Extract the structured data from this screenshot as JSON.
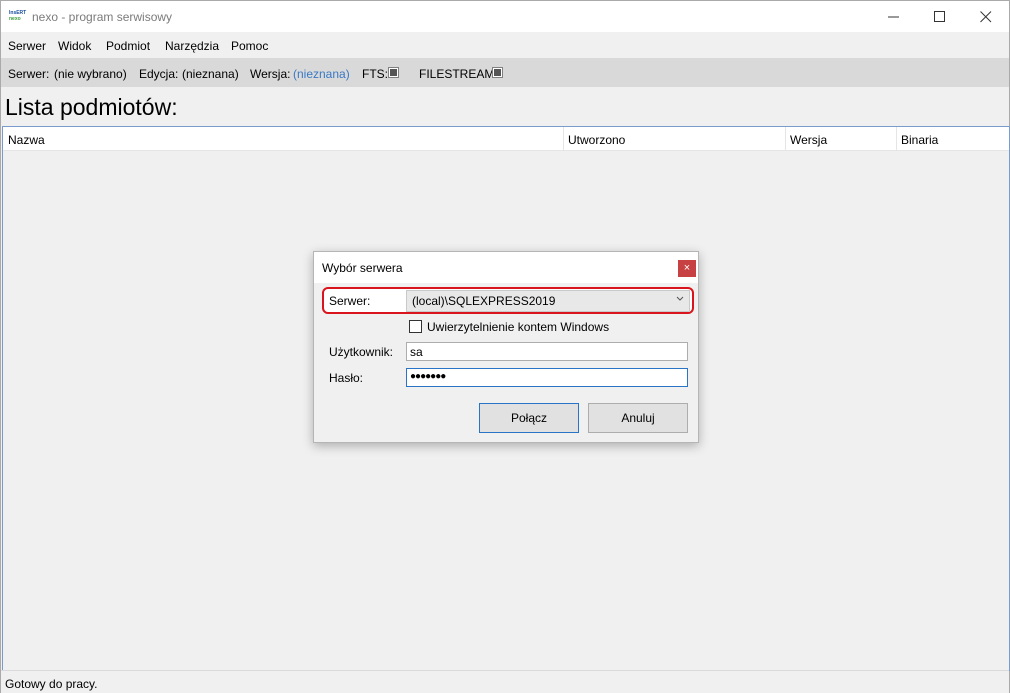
{
  "window": {
    "logo_top": "InsERT",
    "logo_bottom": "nexo",
    "title": "nexo - program serwisowy"
  },
  "menu": {
    "items": [
      {
        "label": "Serwer"
      },
      {
        "label": "Widok"
      },
      {
        "label": "Podmiot"
      },
      {
        "label": "Narzędzia"
      },
      {
        "label": "Pomoc"
      }
    ]
  },
  "info": {
    "server_label": "Serwer:",
    "server_value": "(nie wybrano)",
    "edition_label": "Edycja:",
    "edition_value": "(nieznana)",
    "version_label": "Wersja:",
    "version_value": "(nieznana)",
    "fts_label": "FTS:",
    "filestream_label": "FILESTREAM:",
    "link_color": "#3a79c4"
  },
  "main": {
    "heading": "Lista podmiotów:",
    "columns": [
      {
        "label": "Nazwa"
      },
      {
        "label": "Utworzono"
      },
      {
        "label": "Wersja"
      },
      {
        "label": "Binaria"
      }
    ]
  },
  "status": {
    "text": "Gotowy do pracy."
  },
  "dialog": {
    "title": "Wybór serwera",
    "close_glyph": "×",
    "server_label": "Serwer:",
    "server_value": "(local)\\SQLEXPRESS2019",
    "windows_auth_label": "Uwierzytelnienie kontem Windows",
    "windows_auth_checked": false,
    "user_label": "Użytkownik:",
    "user_value": "sa",
    "password_label": "Hasło:",
    "password_mask": "●●●●●●●",
    "connect_label": "Połącz",
    "cancel_label": "Anuluj",
    "highlight_color": "#d9141c"
  }
}
